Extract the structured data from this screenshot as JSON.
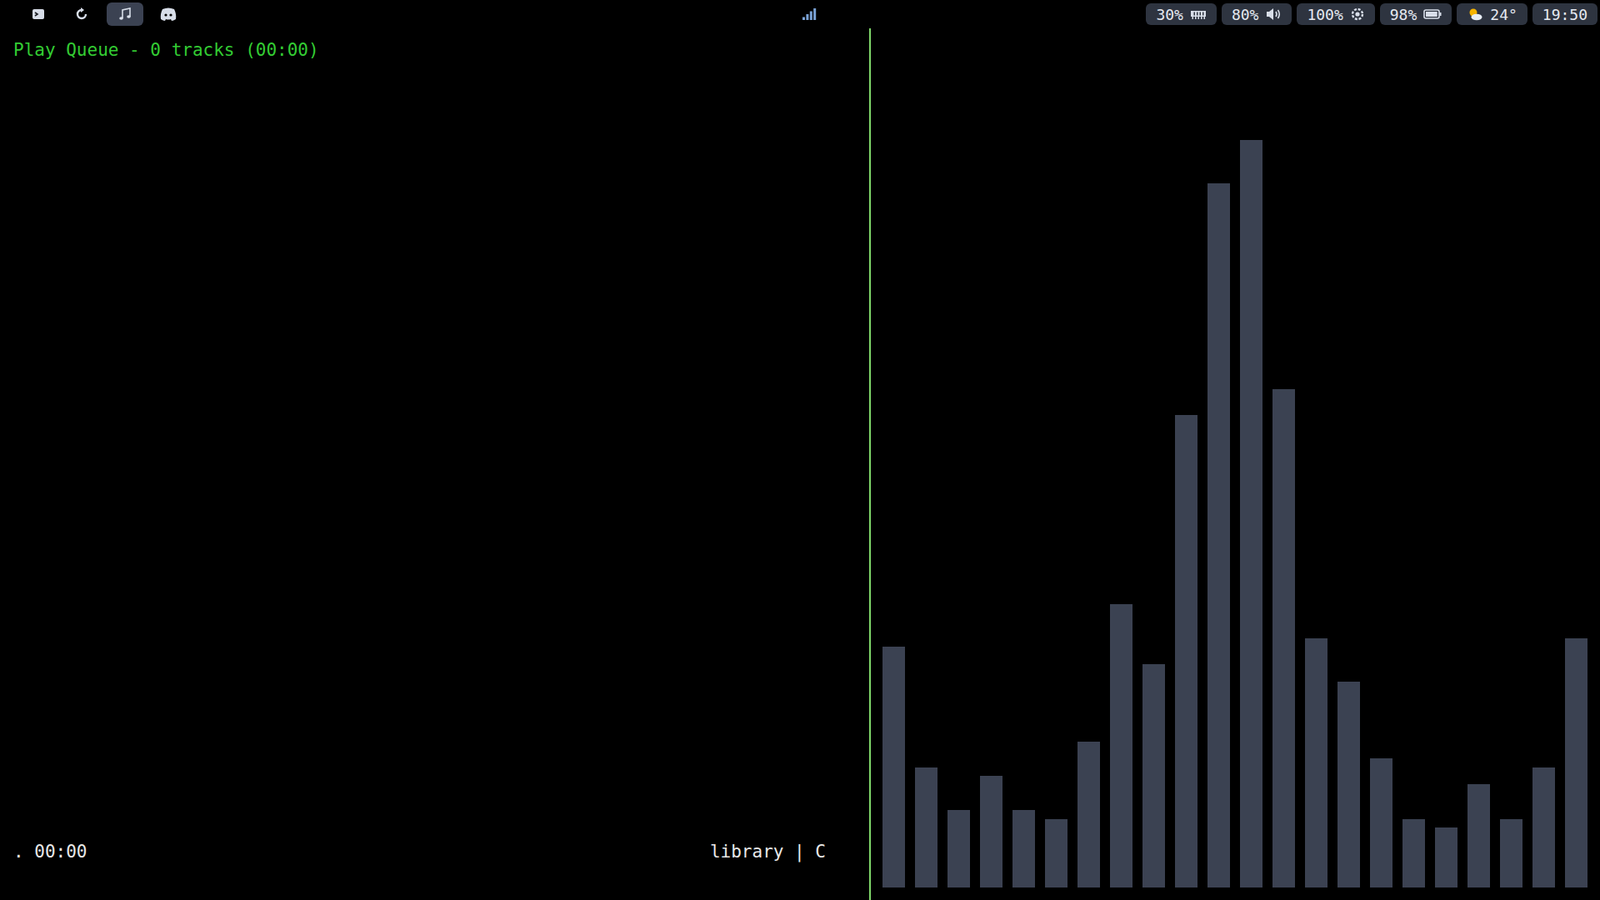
{
  "topbar": {
    "workspaces": [
      {
        "kind": "terminal",
        "selected": false
      },
      {
        "kind": "refresh",
        "selected": false
      },
      {
        "kind": "music",
        "selected": true
      },
      {
        "kind": "discord",
        "selected": false
      }
    ],
    "network": {
      "level": 1
    },
    "status": [
      {
        "kind": "memory",
        "text": "30%"
      },
      {
        "kind": "volume",
        "text": "80%"
      },
      {
        "kind": "brightness",
        "text": "100%"
      },
      {
        "kind": "battery",
        "text": "98%",
        "level": 0.98
      },
      {
        "kind": "weather",
        "text": "24°"
      },
      {
        "kind": "clock",
        "text": "19:50"
      }
    ]
  },
  "player": {
    "title": "Play Queue - 0 tracks (00:00)",
    "state": ". 00:00",
    "mode": "library | C"
  },
  "visualizer": {
    "values": [
      28,
      14,
      9,
      13,
      9,
      8,
      17,
      33,
      26,
      55,
      82,
      87,
      58,
      29,
      24,
      15,
      8,
      7,
      12,
      8,
      14,
      29
    ]
  }
}
